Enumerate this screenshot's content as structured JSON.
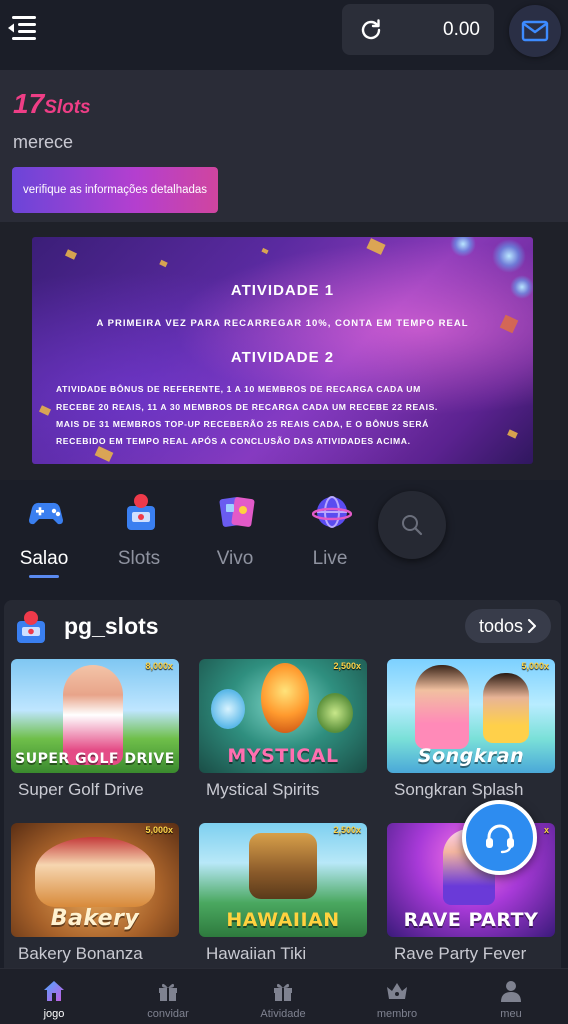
{
  "header": {
    "balance": "0.00",
    "menu_icon": "menu-icon",
    "refresh_icon": "refresh-icon",
    "mail_icon": "mail-icon"
  },
  "promo": {
    "number": "17",
    "brand": "Slots",
    "subtitle": "merece",
    "details_button": "verifique as informações detalhadas"
  },
  "banner": {
    "title1": "ATIVIDADE 1",
    "line1": "A PRIMEIRA VEZ PARA RECARREGAR 10%, CONTA EM TEMPO REAL",
    "title2": "ATIVIDADE 2",
    "p1": "ATIVIDADE BÔNUS DE REFERENTE, 1 A 10 MEMBROS DE RECARGA CADA UM",
    "p2": "RECEBE 20 REAIS, 11 A 30 MEMBROS DE RECARGA CADA UM RECEBE 22 REAIS.",
    "p3": "MAIS DE 31 MEMBROS TOP-UP RECEBERÃO 25 REAIS CADA, E O BÔNUS SERÁ",
    "p4": "RECEBIDO EM TEMPO REAL APÓS A CONCLUSÃO DAS ATIVIDADES ACIMA."
  },
  "categories": [
    {
      "label": "Salao",
      "icon": "gamepad-icon",
      "active": true
    },
    {
      "label": "Slots",
      "icon": "slot-machine-icon",
      "active": false
    },
    {
      "label": "Vivo",
      "icon": "cards-icon",
      "active": false
    },
    {
      "label": "Live",
      "icon": "globe-icon",
      "active": false
    }
  ],
  "games_section": {
    "title": "pg_slots",
    "all_label": "todos",
    "games": [
      {
        "name": "Super Golf Drive",
        "logo": "SUPER GOLF DRIVE",
        "multiplier": "8,000x"
      },
      {
        "name": "Mystical Spirits",
        "logo": "MYSTICAL",
        "multiplier": "2,500x"
      },
      {
        "name": "Songkran Splash",
        "logo": "Songkran",
        "multiplier": "5,000x"
      },
      {
        "name": "Bakery Bonanza",
        "logo": "Bakery",
        "multiplier": "5,000x"
      },
      {
        "name": "Hawaiian Tiki",
        "logo": "HAWAIIAN",
        "multiplier": "2,500x"
      },
      {
        "name": "Rave Party Fever",
        "logo": "RAVE PARTY",
        "multiplier": "x"
      }
    ]
  },
  "bottom_nav": [
    {
      "label": "jogo",
      "icon": "home-icon",
      "active": true
    },
    {
      "label": "convidar",
      "icon": "gift-icon",
      "active": false
    },
    {
      "label": "Atividade",
      "icon": "gift-icon",
      "active": false
    },
    {
      "label": "membro",
      "icon": "crown-icon",
      "active": false
    },
    {
      "label": "meu",
      "icon": "user-icon",
      "active": false
    }
  ],
  "colors": {
    "background": "#1b1e28",
    "accent_pink": "#ee3e86",
    "accent_blue": "#2d8cf0"
  }
}
